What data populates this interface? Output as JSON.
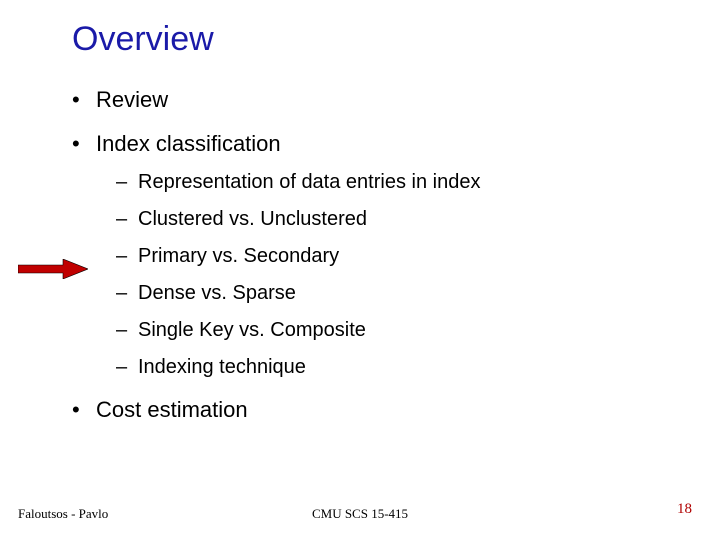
{
  "title": "Overview",
  "bullets": {
    "b0": "Review",
    "b1": "Index classification",
    "b2": "Cost estimation"
  },
  "sub": {
    "s0": "Representation of data entries in index",
    "s1": "Clustered vs. Unclustered",
    "s2": "Primary vs. Secondary",
    "s3": "Dense vs. Sparse",
    "s4": "Single Key vs. Composite",
    "s5": "Indexing technique"
  },
  "footer": {
    "left": "Faloutsos - Pavlo",
    "center": "CMU SCS 15-415",
    "right": "18"
  }
}
